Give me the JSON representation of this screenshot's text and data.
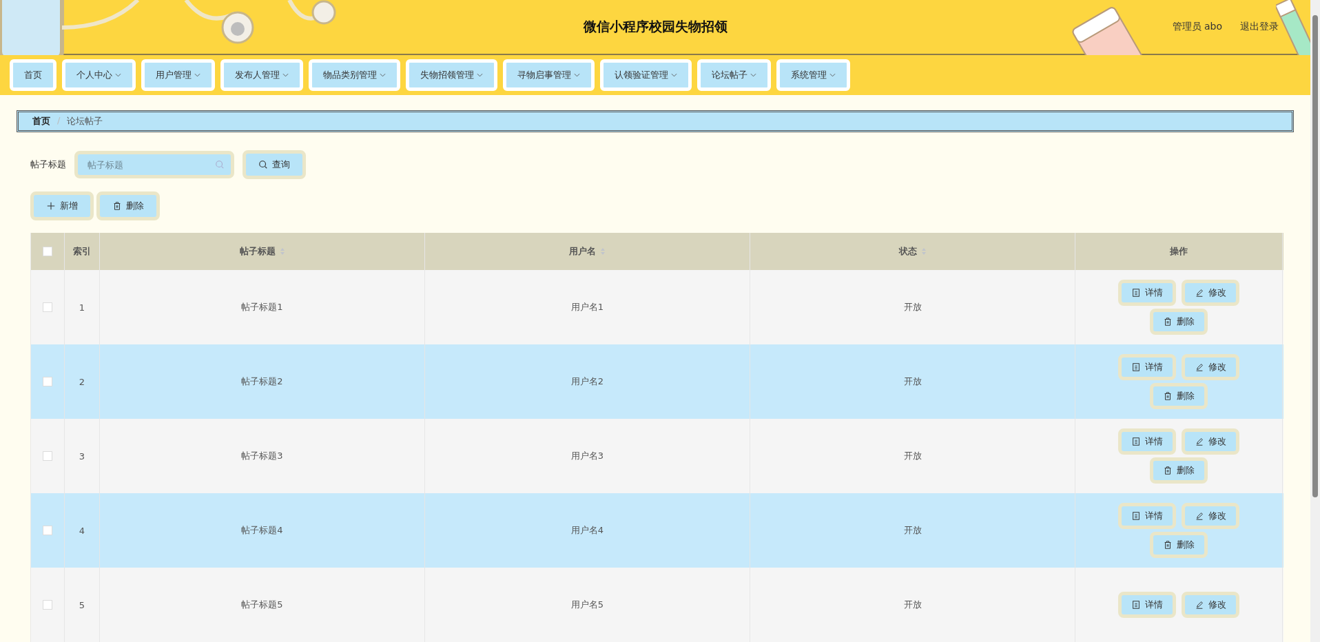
{
  "header": {
    "title": "微信小程序校园失物招领",
    "user": "管理员 abo",
    "logout": "退出登录"
  },
  "nav": [
    {
      "label": "首页",
      "has_menu": false
    },
    {
      "label": "个人中心",
      "has_menu": true
    },
    {
      "label": "用户管理",
      "has_menu": true
    },
    {
      "label": "发布人管理",
      "has_menu": true
    },
    {
      "label": "物品类别管理",
      "has_menu": true
    },
    {
      "label": "失物招领管理",
      "has_menu": true
    },
    {
      "label": "寻物启事管理",
      "has_menu": true
    },
    {
      "label": "认领验证管理",
      "has_menu": true
    },
    {
      "label": "论坛帖子",
      "has_menu": true
    },
    {
      "label": "系统管理",
      "has_menu": true
    }
  ],
  "breadcrumb": {
    "items": [
      "首页",
      "论坛帖子"
    ],
    "separator": "/"
  },
  "search": {
    "label": "帖子标题",
    "placeholder": "帖子标题",
    "button": "查询"
  },
  "actions": [
    "新增",
    "删除"
  ],
  "table": {
    "select_all_checked": false,
    "columns": [
      {
        "label": "索引",
        "sortable": false
      },
      {
        "label": "帖子标题",
        "sortable": true
      },
      {
        "label": "用户名",
        "sortable": true
      },
      {
        "label": "状态",
        "sortable": true
      },
      {
        "label": "操作",
        "sortable": false
      }
    ],
    "rows": [
      {
        "checked": false,
        "index": "1",
        "title": "帖子标题1",
        "user": "用户名1",
        "status": "开放",
        "actions": [
          "详情",
          "修改",
          "删除"
        ]
      },
      {
        "checked": false,
        "index": "2",
        "title": "帖子标题2",
        "user": "用户名2",
        "status": "开放",
        "actions": [
          "详情",
          "修改",
          "删除"
        ]
      },
      {
        "checked": false,
        "index": "3",
        "title": "帖子标题3",
        "user": "用户名3",
        "status": "开放",
        "actions": [
          "详情",
          "修改",
          "删除"
        ]
      },
      {
        "checked": false,
        "index": "4",
        "title": "帖子标题4",
        "user": "用户名4",
        "status": "开放",
        "actions": [
          "详情",
          "修改",
          "删除"
        ]
      },
      {
        "checked": false,
        "index": "5",
        "title": "帖子标题5",
        "user": "用户名5",
        "status": "开放",
        "actions": [
          "详情",
          "修改"
        ]
      }
    ]
  }
}
